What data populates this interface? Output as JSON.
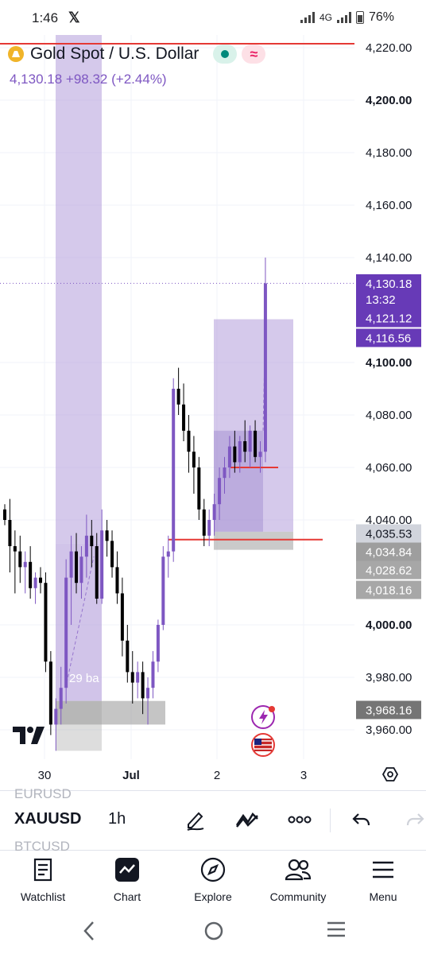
{
  "status_bar": {
    "time": "1:46",
    "app_icon": "x-icon",
    "network": "4G",
    "battery": "76%"
  },
  "header": {
    "symbol_name": "Gold Spot / U.S. Dollar",
    "last_price": "4,130.18",
    "change": "+98.32",
    "change_pct": "(+2.44%)"
  },
  "price_axis": {
    "ticks": [
      {
        "label": "4,220.00",
        "value": 4220,
        "bold": false
      },
      {
        "label": "4,200.00",
        "value": 4200,
        "bold": true
      },
      {
        "label": "4,180.00",
        "value": 4180,
        "bold": false
      },
      {
        "label": "4,160.00",
        "value": 4160,
        "bold": false
      },
      {
        "label": "4,140.00",
        "value": 4140,
        "bold": false
      },
      {
        "label": "4,100.00",
        "value": 4100,
        "bold": true
      },
      {
        "label": "4,080.00",
        "value": 4080,
        "bold": false
      },
      {
        "label": "4,060.00",
        "value": 4060,
        "bold": false
      },
      {
        "label": "4,040.00",
        "value": 4040,
        "bold": false
      },
      {
        "label": "4,000.00",
        "value": 4000,
        "bold": true
      },
      {
        "label": "3,980.00",
        "value": 3980,
        "bold": false
      },
      {
        "label": "3,960.00",
        "value": 3960,
        "bold": false
      }
    ],
    "badges": [
      {
        "lines": [
          "4,130.18",
          "13:32"
        ],
        "value": 4130.18,
        "style": "purple"
      },
      {
        "lines": [
          "4,121.12"
        ],
        "value": 4121.12,
        "style": "purple"
      },
      {
        "lines": [
          "4,116.56"
        ],
        "value": 4116.56,
        "style": "purple"
      },
      {
        "lines": [
          "4,035.53"
        ],
        "value": 4035.53,
        "style": "gray"
      },
      {
        "lines": [
          "4,034.84"
        ],
        "value": 4034.84,
        "style": "gray"
      },
      {
        "lines": [
          "4,028.62"
        ],
        "value": 4028.62,
        "style": "gray"
      },
      {
        "lines": [
          "4,018.16"
        ],
        "value": 4018.16,
        "style": "gray"
      },
      {
        "lines": [
          "3,968.16"
        ],
        "value": 3968.16,
        "style": "gray"
      }
    ]
  },
  "time_axis": {
    "ticks": [
      {
        "label": "30",
        "bold": false
      },
      {
        "label": "Jul",
        "bold": true
      },
      {
        "label": "2",
        "bold": false
      },
      {
        "label": "3",
        "bold": false
      }
    ]
  },
  "annotations": {
    "bars_label": "29 ba"
  },
  "chart_data": {
    "type": "candlestick",
    "symbol": "XAUUSD",
    "interval": "1h",
    "ylim": [
      3950,
      4230
    ],
    "horizontal_lines": [
      4221.5,
      4032.5
    ],
    "candles": [
      {
        "o": 4044,
        "h": 4046,
        "l": 4038,
        "c": 4040
      },
      {
        "o": 4040,
        "h": 4048,
        "l": 4020,
        "c": 4030
      },
      {
        "o": 4030,
        "h": 4036,
        "l": 4012,
        "c": 4028
      },
      {
        "o": 4028,
        "h": 4034,
        "l": 4016,
        "c": 4022
      },
      {
        "o": 4022,
        "h": 4028,
        "l": 4012,
        "c": 4024
      },
      {
        "o": 4024,
        "h": 4030,
        "l": 4010,
        "c": 4014
      },
      {
        "o": 4014,
        "h": 4020,
        "l": 4008,
        "c": 4018
      },
      {
        "o": 4018,
        "h": 4022,
        "l": 4012,
        "c": 4016
      },
      {
        "o": 4016,
        "h": 4020,
        "l": 3982,
        "c": 3986
      },
      {
        "o": 3986,
        "h": 3990,
        "l": 3958,
        "c": 3962
      },
      {
        "o": 3962,
        "h": 3972,
        "l": 3952,
        "c": 3968
      },
      {
        "o": 3968,
        "h": 3984,
        "l": 3962,
        "c": 3976
      },
      {
        "o": 3976,
        "h": 4025,
        "l": 3970,
        "c": 4018
      },
      {
        "o": 4018,
        "h": 4034,
        "l": 4000,
        "c": 4028
      },
      {
        "o": 4028,
        "h": 4035,
        "l": 4012,
        "c": 4016
      },
      {
        "o": 4016,
        "h": 4030,
        "l": 4010,
        "c": 4026
      },
      {
        "o": 4026,
        "h": 4042,
        "l": 4018,
        "c": 4034
      },
      {
        "o": 4034,
        "h": 4040,
        "l": 4022,
        "c": 4030
      },
      {
        "o": 4030,
        "h": 4035,
        "l": 4008,
        "c": 4010
      },
      {
        "o": 4010,
        "h": 4044,
        "l": 4008,
        "c": 4036
      },
      {
        "o": 4036,
        "h": 4040,
        "l": 4026,
        "c": 4032
      },
      {
        "o": 4032,
        "h": 4036,
        "l": 4018,
        "c": 4022
      },
      {
        "o": 4022,
        "h": 4028,
        "l": 4008,
        "c": 4012
      },
      {
        "o": 4012,
        "h": 4018,
        "l": 3988,
        "c": 3994
      },
      {
        "o": 3994,
        "h": 4000,
        "l": 3978,
        "c": 3982
      },
      {
        "o": 3982,
        "h": 3990,
        "l": 3970,
        "c": 3978
      },
      {
        "o": 3978,
        "h": 3986,
        "l": 3972,
        "c": 3982
      },
      {
        "o": 3982,
        "h": 3986,
        "l": 3966,
        "c": 3972
      },
      {
        "o": 3972,
        "h": 3980,
        "l": 3962,
        "c": 3976
      },
      {
        "o": 3976,
        "h": 3990,
        "l": 3972,
        "c": 3986
      },
      {
        "o": 3986,
        "h": 4002,
        "l": 3982,
        "c": 4000
      },
      {
        "o": 4000,
        "h": 4030,
        "l": 3998,
        "c": 4026
      },
      {
        "o": 4026,
        "h": 4034,
        "l": 4018,
        "c": 4028
      },
      {
        "o": 4028,
        "h": 4094,
        "l": 4024,
        "c": 4090
      },
      {
        "o": 4090,
        "h": 4098,
        "l": 4080,
        "c": 4084
      },
      {
        "o": 4084,
        "h": 4092,
        "l": 4070,
        "c": 4074
      },
      {
        "o": 4074,
        "h": 4080,
        "l": 4058,
        "c": 4066
      },
      {
        "o": 4066,
        "h": 4072,
        "l": 4050,
        "c": 4060
      },
      {
        "o": 4060,
        "h": 4064,
        "l": 4040,
        "c": 4044
      },
      {
        "o": 4044,
        "h": 4048,
        "l": 4030,
        "c": 4034
      },
      {
        "o": 4034,
        "h": 4044,
        "l": 4030,
        "c": 4040
      },
      {
        "o": 4040,
        "h": 4050,
        "l": 4034,
        "c": 4046
      },
      {
        "o": 4046,
        "h": 4060,
        "l": 4040,
        "c": 4056
      },
      {
        "o": 4056,
        "h": 4064,
        "l": 4050,
        "c": 4060
      },
      {
        "o": 4060,
        "h": 4072,
        "l": 4056,
        "c": 4068
      },
      {
        "o": 4068,
        "h": 4074,
        "l": 4058,
        "c": 4062
      },
      {
        "o": 4062,
        "h": 4072,
        "l": 4058,
        "c": 4070
      },
      {
        "o": 4070,
        "h": 4078,
        "l": 4062,
        "c": 4066
      },
      {
        "o": 4066,
        "h": 4076,
        "l": 4060,
        "c": 4074
      },
      {
        "o": 4074,
        "h": 4078,
        "l": 4062,
        "c": 4064
      },
      {
        "o": 4064,
        "h": 4070,
        "l": 4058,
        "c": 4066
      },
      {
        "o": 4066,
        "h": 4140,
        "l": 4062,
        "c": 4130.18
      }
    ]
  },
  "toolbar": {
    "symbol": "XAUUSD",
    "interval": "1h",
    "symbol_prev": "EURUSD",
    "symbol_next": "BTCUSD"
  },
  "bottom_nav": [
    {
      "label": "Watchlist",
      "icon": "watchlist-icon"
    },
    {
      "label": "Chart",
      "icon": "chart-icon"
    },
    {
      "label": "Explore",
      "icon": "compass-icon"
    },
    {
      "label": "Community",
      "icon": "community-icon"
    },
    {
      "label": "Menu",
      "icon": "menu-icon"
    }
  ],
  "colors": {
    "candle_up": "#7e57c2",
    "candle_down": "#000000",
    "zone_fill": "#b39ddb",
    "stop_fill": "#9e9e9e",
    "line_red": "#e53935"
  }
}
